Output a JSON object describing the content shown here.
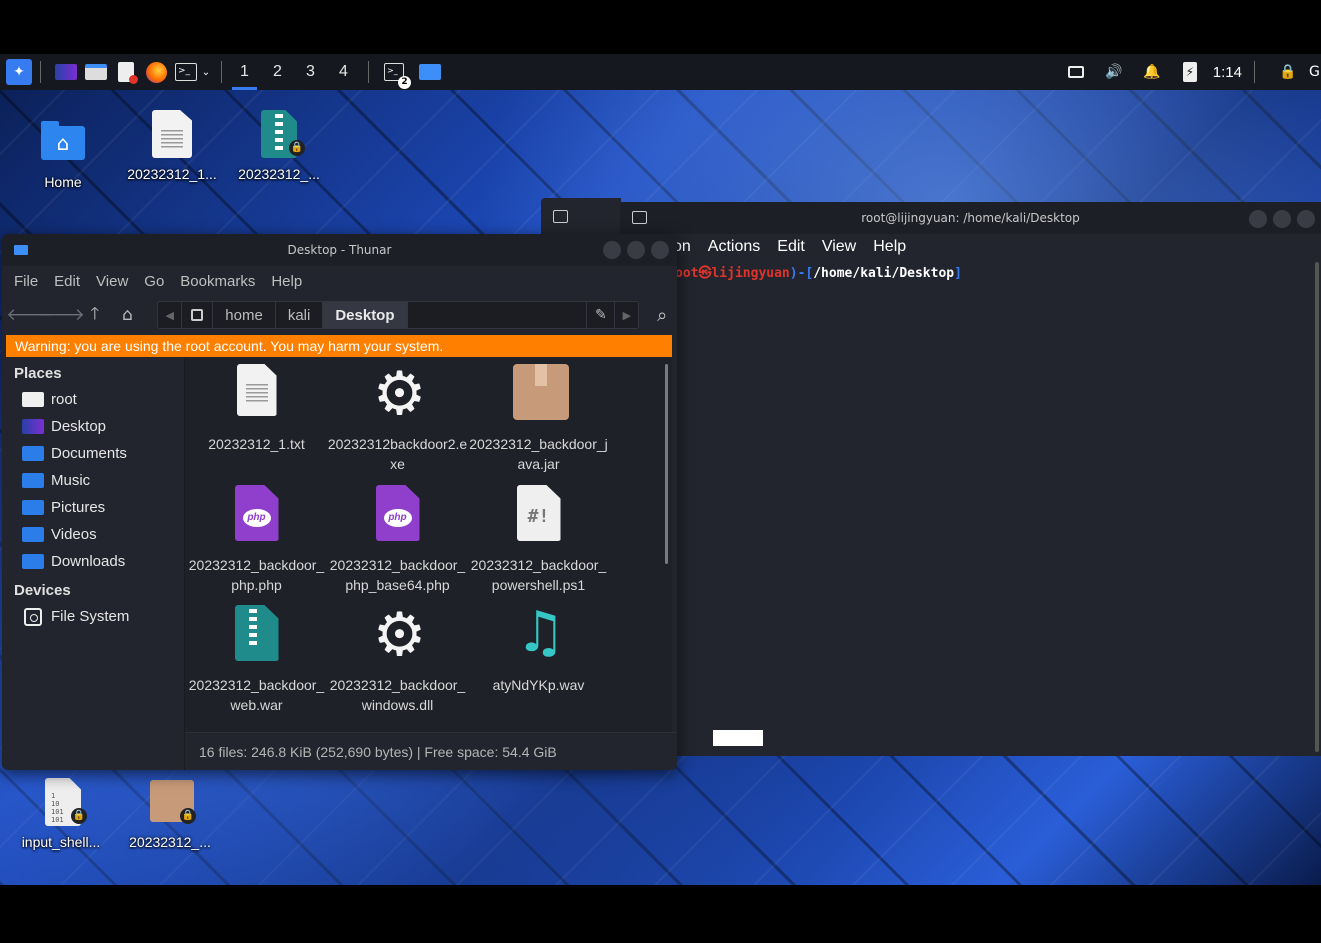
{
  "panel": {
    "workspaces": [
      "1",
      "2",
      "3",
      "4"
    ],
    "active_workspace": "1",
    "clock": "1:14",
    "icons_left": [
      "kali-menu-icon",
      "show-desktop-icon",
      "file-manager-icon",
      "text-editor-icon",
      "firefox-icon",
      "terminal-icon",
      "dropdown-icon"
    ],
    "icons_right": [
      "display-icon",
      "volume-icon",
      "notification-icon",
      "battery-icon",
      "lock-icon"
    ],
    "task_badge": "2"
  },
  "desktop": {
    "icons": [
      {
        "label": "Home",
        "icon": "home-folder-icon"
      },
      {
        "label": "20232312_1...",
        "icon": "text-file-icon"
      },
      {
        "label": "20232312_...",
        "icon": "archive-file-icon"
      },
      {
        "label": "input_shell...",
        "icon": "binary-file-icon"
      },
      {
        "label": "20232312_...",
        "icon": "package-file-icon"
      }
    ]
  },
  "terminal": {
    "title": "root@lijingyuan: /home/kali/Desktop",
    "menu": [
      "on",
      "Actions",
      "Edit",
      "View",
      "Help"
    ],
    "prompt_user": "oot㉿lijingyuan",
    "prompt_bracket_open": ")-[",
    "prompt_path": "/home/kali/Desktop",
    "prompt_bracket_close": "]"
  },
  "thunar": {
    "title": "Desktop - Thunar",
    "menu": [
      "File",
      "Edit",
      "View",
      "Go",
      "Bookmarks",
      "Help"
    ],
    "breadcrumbs": [
      "home",
      "kali",
      "Desktop"
    ],
    "active_crumb": "Desktop",
    "warning": "Warning: you are using the root account. You may harm your system.",
    "sidebar": {
      "places_header": "Places",
      "places": [
        "root",
        "Desktop",
        "Documents",
        "Music",
        "Pictures",
        "Videos",
        "Downloads"
      ],
      "devices_header": "Devices",
      "devices": [
        "File System"
      ]
    },
    "files": [
      {
        "name": "20232312_1.txt",
        "icon": "text-file-icon"
      },
      {
        "name": "20232312backdoor2.exe",
        "icon": "executable-gear-icon"
      },
      {
        "name": "20232312_backdoor_java.jar",
        "icon": "jar-package-icon"
      },
      {
        "name": "20232312_backdoor_php.php",
        "icon": "php-file-icon"
      },
      {
        "name": "20232312_backdoor_php_base64.php",
        "icon": "php-file-icon"
      },
      {
        "name": "20232312_backdoor_powershell.ps1",
        "icon": "script-file-icon"
      },
      {
        "name": "20232312_backdoor_web.war",
        "icon": "archive-file-icon"
      },
      {
        "name": "20232312_backdoor_windows.dll",
        "icon": "library-gear-icon"
      },
      {
        "name": "atyNdYKp.wav",
        "icon": "audio-file-icon"
      }
    ],
    "status": "16 files: 246.8 KiB (252,690 bytes) | Free space: 54.4 GiB"
  }
}
